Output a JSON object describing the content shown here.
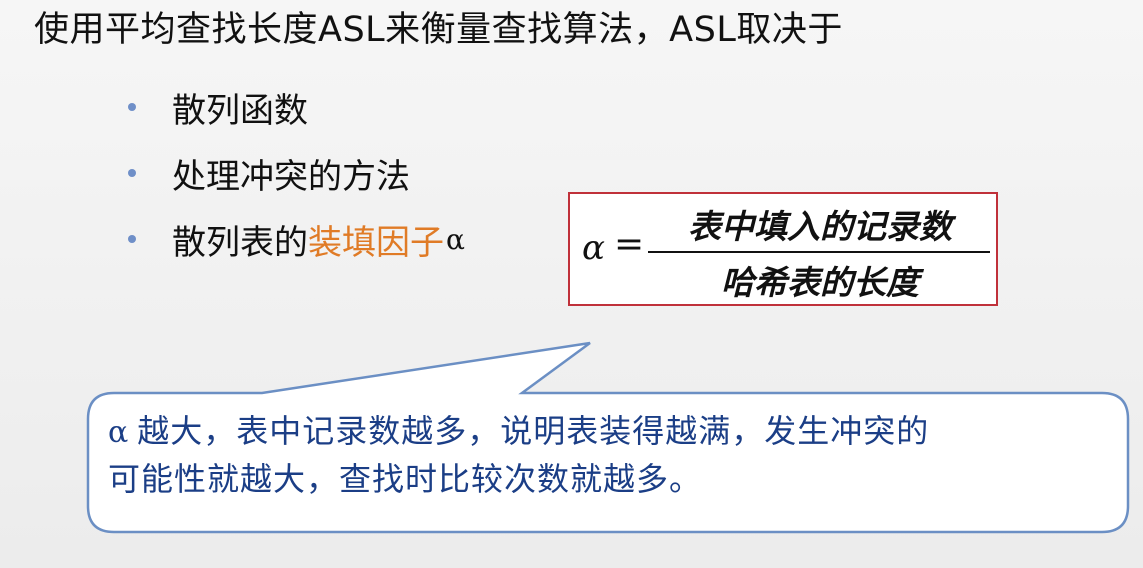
{
  "slide": {
    "title": "使用平均查找长度ASL来衡量查找算法，ASL取决于",
    "bullets": [
      {
        "text": "散列函数"
      },
      {
        "text": "处理冲突的方法"
      },
      {
        "text_before": "散列表的",
        "highlight": "装填因子",
        "symbol": "α"
      }
    ],
    "formula": {
      "lhs": "α",
      "equals": "=",
      "numerator": "表中填入的记录数",
      "denominator": "哈希表的长度"
    },
    "callout": {
      "symbol": "α",
      "line1": "越大，表中记录数越多，说明表装得越满，发生冲突的",
      "line2": "可能性就越大，查找时比较次数就越多。"
    },
    "colors": {
      "highlight": "#e07b26",
      "callout_border": "#6b8fc4",
      "callout_text": "#1b3e86",
      "formula_border": "#c0313a"
    }
  }
}
